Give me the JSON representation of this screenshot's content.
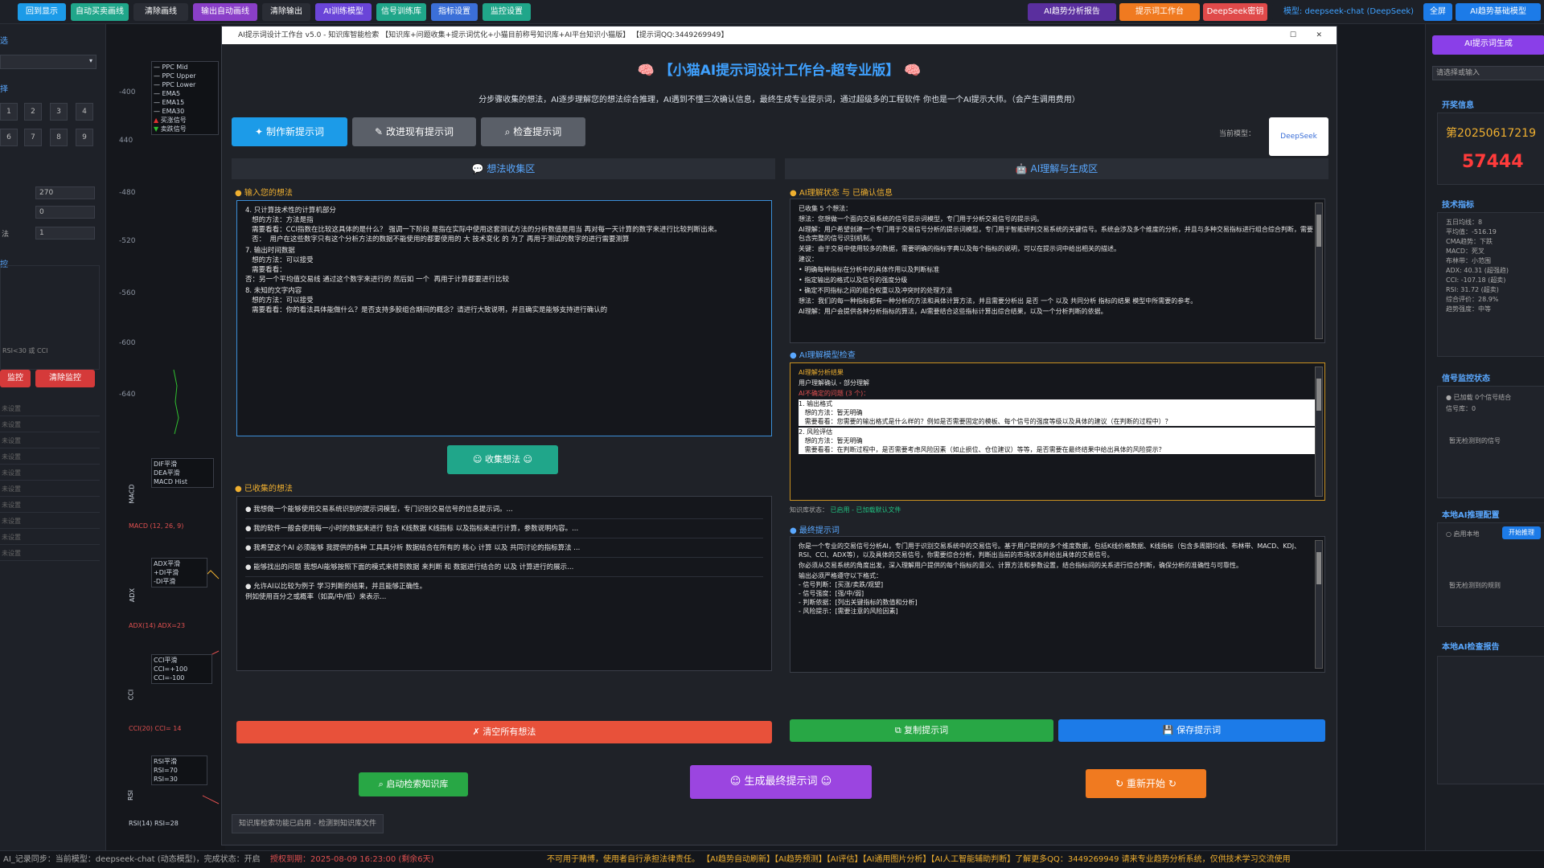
{
  "topbar": {
    "left_buttons": [
      {
        "label": "回到显示",
        "color": "#1c9be8"
      },
      {
        "label": "自动买卖画线",
        "color": "#20a68a"
      },
      {
        "label": "清除画线",
        "color": "#2a2d35"
      },
      {
        "label": "输出自动画线",
        "color": "#8a3fc8"
      },
      {
        "label": "清除输出",
        "color": "#2a2d35"
      },
      {
        "label": "AI训练模型",
        "color": "#6a45d8"
      },
      {
        "label": "信号训练库",
        "color": "#20a68a"
      },
      {
        "label": "指标设置",
        "color": "#3b6fd8"
      },
      {
        "label": "监控设置",
        "color": "#20a68a"
      }
    ],
    "right_buttons": [
      {
        "label": "AI趋势分析报告",
        "color": "#5a2f9e"
      },
      {
        "label": "提示词工作台",
        "color": "#f07a20"
      },
      {
        "label": "DeepSeek密钥",
        "color": "#e04a4a"
      },
      {
        "label": "模型: deepseek-chat (DeepSeek)",
        "color": "#1d2027"
      },
      {
        "label": "全屏",
        "color": "#1c7be8"
      },
      {
        "label": "AI趋势基础模型",
        "color": "#1c7be8"
      }
    ]
  },
  "left_panel": {
    "title1": "选",
    "title2": "择",
    "numbers": [
      "1",
      "2",
      "3",
      "4",
      "6",
      "7",
      "8",
      "9"
    ],
    "inputs": [
      "270",
      "0",
      "1"
    ],
    "input_labels": [
      "",
      "",
      "法"
    ],
    "title3": "控",
    "rsi_note": "RSI<30 或 CCI",
    "monitor_label": "监控",
    "clear_monitor_label": "清除监控",
    "list_items": [
      "未设置",
      "未设置",
      "未设置",
      "未设置",
      "未设置",
      "未设置",
      "未设置",
      "未设置",
      "未设置",
      "未设置"
    ]
  },
  "chart": {
    "yticks": [
      "-400",
      "440",
      "-480",
      "-520",
      "-560",
      "-600",
      "-640"
    ],
    "legend1": [
      "PPC Mid",
      "PPC Upper",
      "PPC Lower",
      "EMA5",
      "EMA15",
      "EMA30",
      "买涨信号",
      "卖跌信号"
    ],
    "macd_legend": [
      "DIF平滑",
      "DEA平滑",
      "MACD Hist"
    ],
    "macd_label": "MACD (12, 26, 9)",
    "adx_legend": [
      "ADX平滑",
      "+DI平滑",
      "-DI平滑"
    ],
    "adx_label": "ADX(14) ADX=23",
    "cci_legend": [
      "CCI平滑",
      "CCI=+100",
      "CCI=-100"
    ],
    "cci_label": "CCI(20) CCI= 14",
    "rsi_legend": [
      "RSI平滑",
      "RSI=70",
      "RSI=30"
    ],
    "rsi_label": "RSI(14) RSI=28",
    "side_labels": [
      "MACD",
      "ADX",
      "CCI",
      "RSI"
    ]
  },
  "window": {
    "title": "AI提示词设计工作台 v5.0 - 知识库智能检索 【知识库+问题收集+提示词优化+小猫目前称号知识库+AI平台知识小猫版】 【提示词QQ:3449269949】",
    "heading": "【小猫AI提示词设计工作台-超专业版】",
    "subtitle": "分步骤收集的想法，AI逐步理解您的想法综合推理，AI遇到不懂三次确认信息，最终生成专业提示词，通过超级多的工程软件 你也是一个AI提示大师。（会产生调用费用）",
    "mode_buttons": [
      "制作新提示词",
      "改进现有提示词",
      "检查提示词"
    ],
    "current_model_label": "当前模型：",
    "current_model": "DeepSeek",
    "left_header": "想法收集区",
    "right_header": "AI理解与生成区",
    "input_section": "输入您的想法",
    "input_text": [
      "4. 只计算技术性的计算机部分\n   想的方法：方法是指\n   需要看看：CCI指数在比较这具体的是什么？ 强调一下阶段 是指在实际中使用这套测试方法的分析数值是用当 再对每一天计算的数字来进行比较判断出来。\n   否：  用户在这些数字只有这个分析方法的数据不能使用的都要使用的 大 技术变化 的 为了 再用于测试的数字的进行需要测算",
      "7. 输出时间数据\n   想的方法：可以接受\n   需要看看：\n否：另一个平均值交易线 通过这个数字来进行的 然后如 一个  再用于计算都要进行比较",
      "8. 未知的文字内容\n   想的方法：可以接受\n   需要看看：你的看法具体能做什么？是否支持多股组合期间的概念？请进行大致说明，并且确实是能够支持进行确认的"
    ],
    "collect_button": "收集想法",
    "collected_section": "已收集的想法",
    "collected_items": [
      "我想做一个能够使用交易系统识别的提示词模型，专门识别交易信号的信息提示词。...",
      "我的软件一般会使用每一小时的数据来进行 包含 K线数据 K线指标 以及指标来进行计算，参数说明内容。...",
      "我希望这个AI 必须能够 我提供的各种 工具具分析 数据结合在所有的 核心 计算 以及 共同讨论的指标算法 ...",
      "能够找出的问题 我想AI能够按照下面的模式来得到数据 来判断 和 数据进行结合的 以及 计算进行的展示...",
      "允许AI以比较为例子 学习判断的结果，并且能够正确性。\n例如使用百分之或概率（如高/中/低）来表示..."
    ],
    "clear_button": "清空所有想法",
    "ai_section": "AI理解状态 与 已确认信息",
    "ai_status_lines": [
      "已收集 5 个想法：",
      "想法：您想做一个面向交易系统的信号提示词模型，专门用于分析交易信号的提示词。",
      "AI理解：用户希望创建一个专门用于交易信号分析的提示词模型，专门用于智能研判交易系统的关键信号。系统会涉及多个维度的分析，并且与多种交易指标进行组合综合判断，需要包含完整的信号识别机制。",
      "关键：由于交易中使用较多的数据，需要明确的指标字典以及每个指标的说明，可以在提示词中给出相关的描述。",
      "建议：",
      "• 明确每种指标在分析中的具体作用以及判断标准",
      "• 指定输出的格式以及信号的强度分级",
      "• 确定不同指标之间的组合权重以及冲突时的处理方法",
      "想法：我们的每一种指标都有一种分析的方法和具体计算方法，并且需要分析出 是否 一个 以及 共同分析 指标的结果 模型中所需要的参考。",
      "AI理解：用户会提供各种分析指标的算法，AI需要结合这些指标计算出综合结果，以及一个分析判断的依据。"
    ],
    "ai_parse_section": "AI理解模型检查",
    "ai_parse_title": "AI理解分析结果",
    "ai_parse_sub": "用户理解确认 - 部分理解",
    "ai_parse_q": "AI不确定的问题 (3 个)：",
    "ai_parse_items": [
      "1. 输出格式\n   想的方法：暂无明确\n   需要看看：您需要的输出格式是什么样的？例如是否需要固定的模板、每个信号的强度等级以及具体的建议（在判断的过程中）？",
      "2. 风险评估\n   想的方法：暂无明确\n   需要看看：在判断过程中，是否需要考虑风险因素（如止损位、仓位建议）等等，是否需要在最终结果中给出具体的风险提示？"
    ],
    "ai_status_bar": "知识库状态：",
    "ai_status_bar2": "已启用 - 已加载默认文件",
    "final_section": "最终提示词",
    "final_text": [
      "你是一个专业的交易信号分析AI，专门用于识别交易系统中的交易信号。基于用户提供的多个维度数据，包括K线价格数据、K线指标（包含多周期均线、布林带、MACD、KDJ、RSI、CCI、ADX等），以及具体的交易信号，你需要综合分析，判断出当前的市场状态并给出具体的交易信号。",
      "你必须从交易系统的角度出发，深入理解用户提供的每个指标的意义、计算方法和参数设置，结合指标间的关系进行综合判断，确保分析的准确性与可靠性。",
      "输出必须严格遵守以下格式：\n- 信号判断：[买涨/卖跌/观望]\n- 信号强度：[强/中/弱]\n- 判断依据：[列出关键指标的数值和分析]\n- 风险提示：[需要注意的风险因素]"
    ],
    "copy_button": "复制提示词",
    "save_button": "保存提示词",
    "kb_button": "启动检索知识库",
    "generate_button": "生成最终提示词",
    "restart_button": "重新开始",
    "kb_status": "知识库检索功能已启用 - 检测到知识库文件"
  },
  "right_panel": {
    "top_button": "AI提示词生成",
    "field": "请选择或输入",
    "title1": "开奖信息",
    "issue": "第20250617219",
    "number": "57444",
    "number_color": "#ff3b3b",
    "title2": "技术指标",
    "tech_lines": [
      "五日均线：8",
      "平均值：-516.19",
      "CMA趋势：下跌",
      "MACD：死叉",
      "布林带：小范围",
      "ADX: 40.31 (超强趋)",
      "CCI: -107.18 (超卖)",
      "RSI: 31.72 (超卖)",
      "综合评价：28.9%",
      "趋势强度：中等"
    ],
    "title3": "信号监控状态",
    "status_line": "已加载 0个信号结合",
    "status_line2": "信号库：0",
    "empty1": "暂无检测到的信号",
    "title4": "本地AI推理配置",
    "toggle": "启用本地",
    "toggle_btn": "开始推理",
    "empty2": "暂无检测到的规则",
    "title5": "本地AI检查报告"
  },
  "bottombar": {
    "left": "AI_记录同步：当前模型：deepseek-chat (动态模型)，完成状态：开启",
    "warn": "授权到期：2025-08-09 16:23:00 (剩余6天)",
    "marquee": "不可用于赌博，使用者自行承担法律责任。 【AI趋势自动刷新】【AI趋势预测】【AI评估】【AI通用图片分析】【AI人工智能辅助判断】了解更多QQ：3449269949 请来专业趋势分析系统，仅供技术学习交流使用"
  }
}
